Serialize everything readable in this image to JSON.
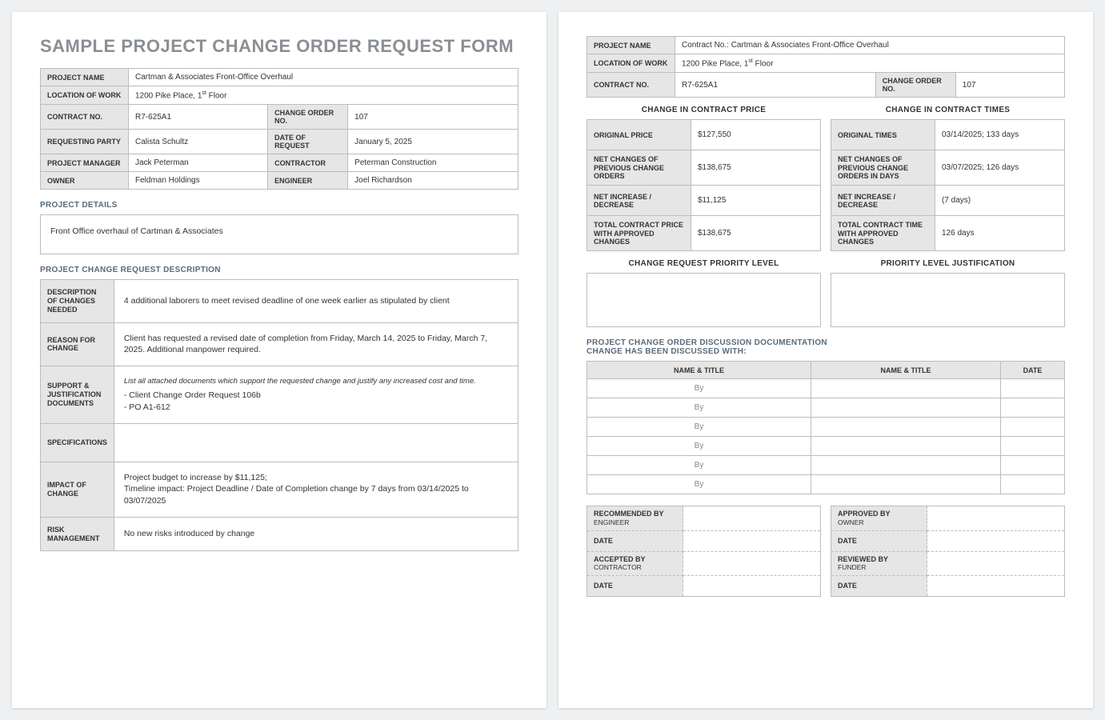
{
  "title": "SAMPLE PROJECT CHANGE ORDER REQUEST FORM",
  "labels": {
    "project_name": "PROJECT NAME",
    "location": "LOCATION OF WORK",
    "contract_no": "CONTRACT NO.",
    "change_order_no": "CHANGE ORDER NO.",
    "requesting_party": "REQUESTING PARTY",
    "date_of_request": "DATE OF REQUEST",
    "project_manager": "PROJECT MANAGER",
    "contractor": "CONTRACTOR",
    "owner": "OWNER",
    "engineer": "ENGINEER",
    "project_details": "PROJECT DETAILS",
    "change_desc_section": "PROJECT CHANGE REQUEST DESCRIPTION",
    "desc_changes": "DESCRIPTION OF CHANGES NEEDED",
    "reason": "REASON FOR CHANGE",
    "support_docs": "SUPPORT & JUSTIFICATION DOCUMENTS",
    "specs": "SPECIFICATIONS",
    "impact": "IMPACT OF CHANGE",
    "risk": "RISK MANAGEMENT",
    "support_note": "List all attached documents which support the requested change and justify any increased cost and time.",
    "change_price_title": "CHANGE IN CONTRACT PRICE",
    "change_times_title": "CHANGE IN CONTRACT TIMES",
    "orig_price": "ORIGINAL PRICE",
    "net_prev_price": "NET CHANGES OF PREVIOUS CHANGE ORDERS",
    "net_incdec": "NET INCREASE / DECREASE",
    "total_price": "TOTAL CONTRACT PRICE WITH APPROVED CHANGES",
    "orig_times": "ORIGINAL TIMES",
    "net_prev_times": "NET CHANGES OF PREVIOUS CHANGE ORDERS IN DAYS",
    "total_time": "TOTAL CONTRACT TIME WITH APPROVED CHANGES",
    "priority": "CHANGE REQUEST PRIORITY LEVEL",
    "priority_just": "PRIORITY LEVEL JUSTIFICATION",
    "discussion_head": "PROJECT CHANGE ORDER DISCUSSION DOCUMENTATION\nCHANGE HAS BEEN DISCUSSED WITH:",
    "name_title": "NAME & TITLE",
    "date": "DATE",
    "by": "By",
    "recommended": "RECOMMENDED BY",
    "engineer_sub": "ENGINEER",
    "accepted": "ACCEPTED BY",
    "contractor_sub": "CONTRACTOR",
    "approved": "APPROVED BY",
    "owner_sub": "OWNER",
    "reviewed": "REVIEWED BY",
    "funder_sub": "FUNDER"
  },
  "header": {
    "project_name": "Cartman & Associates Front-Office Overhaul",
    "location_pre": "1200 Pike Place, 1",
    "location_sup": "st",
    "location_post": " Floor",
    "contract_no": "R7-625A1",
    "change_order_no": "107",
    "requesting_party": "Calista Schultz",
    "date_of_request": "January 5, 2025",
    "project_manager": "Jack Peterman",
    "contractor": "Peterman Construction",
    "owner": "Feldman Holdings",
    "engineer": "Joel Richardson"
  },
  "project_details": "Front Office overhaul of Cartman & Associates",
  "change_request": {
    "description": "4 additional laborers to meet revised deadline of one week earlier as stipulated by client",
    "reason": "Client has requested a revised date of completion from Friday, March 14, 2025 to Friday, March 7, 2025.  Additional manpower required.",
    "support_docs": "- Client Change Order Request 106b\n- PO A1-612",
    "specs": "",
    "impact": "Project budget to increase by $11,125;\nTimeline impact: Project Deadline / Date of Completion change by 7 days from 03/14/2025 to 03/07/2025",
    "risk": "No new risks introduced by change"
  },
  "header2": {
    "project_name": "Contract No.: Cartman & Associates Front-Office Overhaul"
  },
  "price": {
    "original": "$127,550",
    "net_prev": "$138,675",
    "net_inc": "$11,125",
    "total": "$138,675"
  },
  "times": {
    "original": "03/14/2025; 133 days",
    "net_prev": "03/07/2025; 126 days",
    "net_inc": "(7 days)",
    "total": "126 days"
  }
}
